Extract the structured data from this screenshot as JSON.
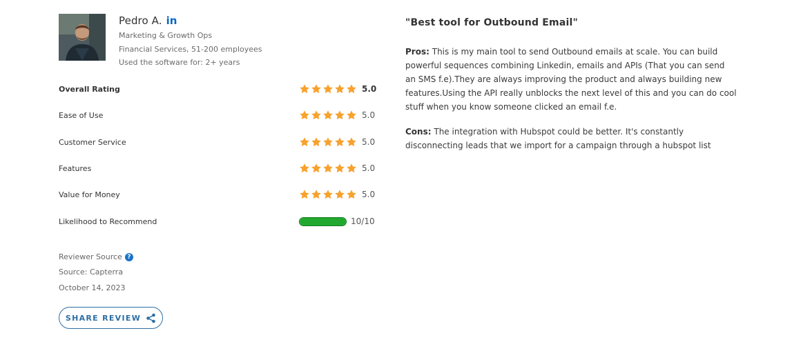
{
  "reviewer": {
    "name": "Pedro A.",
    "social_icon": "linkedin-icon",
    "social_label": "in",
    "role": "Marketing & Growth Ops",
    "company": "Financial Services, 51-200 employees",
    "usage": "Used the software for: 2+ years"
  },
  "ratings": [
    {
      "label": "Overall Rating",
      "score": "5.0",
      "stars": 5
    },
    {
      "label": "Ease of Use",
      "score": "5.0",
      "stars": 5
    },
    {
      "label": "Customer Service",
      "score": "5.0",
      "stars": 5
    },
    {
      "label": "Features",
      "score": "5.0",
      "stars": 5
    },
    {
      "label": "Value for Money",
      "score": "5.0",
      "stars": 5
    }
  ],
  "recommend": {
    "label": "Likelihood to Recommend",
    "score_text": "10/10",
    "value": 10,
    "max": 10
  },
  "source": {
    "title": "Reviewer Source",
    "help_icon": "question-icon",
    "line": "Source: Capterra",
    "date": "October 14, 2023"
  },
  "share": {
    "label": "SHARE REVIEW",
    "icon": "share-icon"
  },
  "review": {
    "title": "\"Best tool for Outbound Email\"",
    "pros_label": "Pros:",
    "pros_text": "This is my main tool to send Outbound emails at scale. You can build powerful sequences combining Linkedin, emails and APIs (That you can send an SMS f.e).They are always improving the product and always building new features.Using the API really unblocks the next level of this and you can do cool stuff when you know someone clicked an email f.e.",
    "cons_label": "Cons:",
    "cons_text": "The integration with Hubspot could be better. It's constantly disconnecting leads that we import for a campaign through a hubspot list"
  },
  "colors": {
    "star": "#f7a22e",
    "bar_fill": "#22a82f",
    "link_blue": "#2d6ea4",
    "linkedin": "#0a66c2"
  }
}
